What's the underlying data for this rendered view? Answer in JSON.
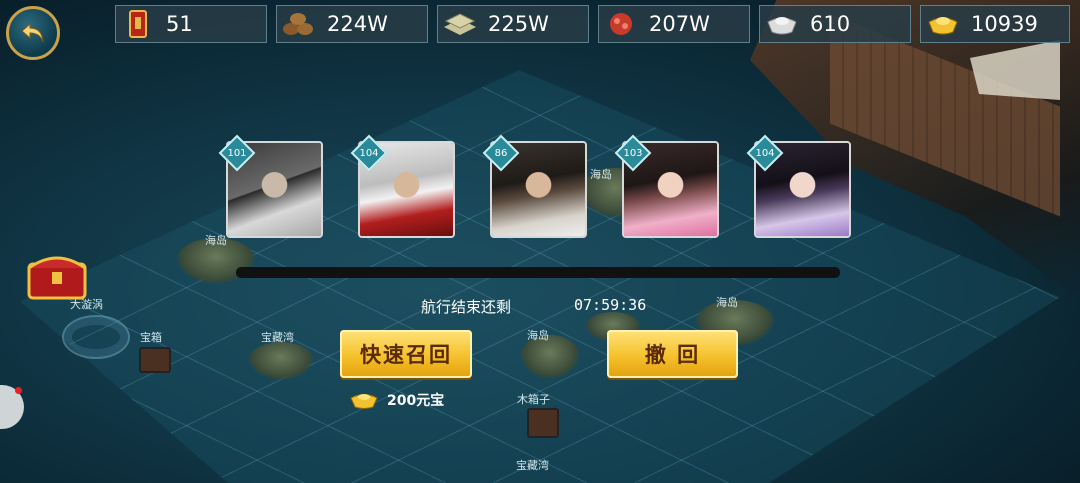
{
  "resources": [
    {
      "icon": "token-icon",
      "value": "51"
    },
    {
      "icon": "wood-icon",
      "value": "224W"
    },
    {
      "icon": "stone-icon",
      "value": "225W"
    },
    {
      "icon": "meat-icon",
      "value": "207W"
    },
    {
      "icon": "silver-icon",
      "value": "610"
    },
    {
      "icon": "gold-ingot-icon",
      "value": "10939"
    }
  ],
  "heroes": [
    {
      "level": "101"
    },
    {
      "level": "104"
    },
    {
      "level": "86"
    },
    {
      "level": "103"
    },
    {
      "level": "104"
    }
  ],
  "voyage": {
    "label": "航行结束还剩",
    "time": "07:59:36"
  },
  "buttons": {
    "quick_recall": "快速召回",
    "withdraw": "撤 回"
  },
  "cost": "200元宝",
  "map_labels": {
    "island_1": "海岛",
    "island_2": "海岛",
    "island_3": "海岛",
    "island_4": "海岛",
    "whirlpool": "大漩涡",
    "chest": "宝箱",
    "treasure_cave_1": "宝藏湾",
    "treasure_cave_2": "宝藏湾",
    "wood_box": "木箱子"
  },
  "colors": {
    "button_gold": "#f5c12c",
    "button_text": "#5a2a00",
    "level_badge": "#2a8a9a"
  }
}
